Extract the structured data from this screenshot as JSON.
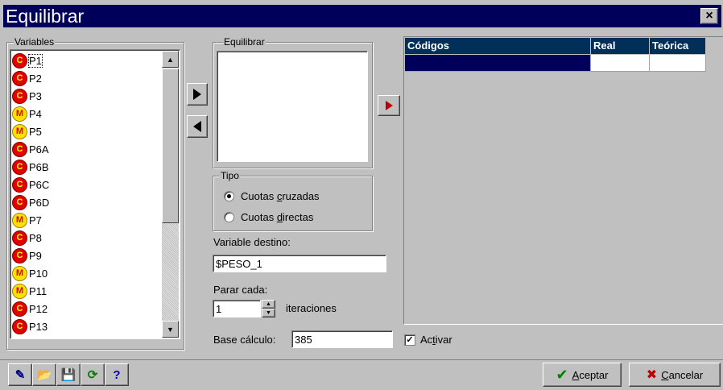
{
  "window": {
    "title": "Equilibrar",
    "close_label": "×"
  },
  "variables": {
    "label": "Variables",
    "items": [
      {
        "name": "P1",
        "type": "C",
        "selected": true
      },
      {
        "name": "P2",
        "type": "C"
      },
      {
        "name": "P3",
        "type": "C"
      },
      {
        "name": "P4",
        "type": "M"
      },
      {
        "name": "P5",
        "type": "M"
      },
      {
        "name": "P6A",
        "type": "C"
      },
      {
        "name": "P6B",
        "type": "C"
      },
      {
        "name": "P6C",
        "type": "C"
      },
      {
        "name": "P6D",
        "type": "C"
      },
      {
        "name": "P7",
        "type": "M"
      },
      {
        "name": "P8",
        "type": "C"
      },
      {
        "name": "P9",
        "type": "C"
      },
      {
        "name": "P10",
        "type": "M"
      },
      {
        "name": "P11",
        "type": "M"
      },
      {
        "name": "P12",
        "type": "C"
      },
      {
        "name": "P13",
        "type": "C"
      }
    ]
  },
  "equilibrar": {
    "label": "Equilibrar"
  },
  "tipo": {
    "label": "Tipo",
    "options": [
      {
        "pre": "Cuotas ",
        "acc": "c",
        "post": "ruzadas",
        "checked": true
      },
      {
        "pre": "Cuotas ",
        "acc": "d",
        "post": "irectas",
        "checked": false
      }
    ]
  },
  "destino": {
    "label": "Variable destino:",
    "value": "$PESO_1"
  },
  "parar": {
    "label": "Parar cada:",
    "value": "1",
    "suffix": "iteraciones"
  },
  "base": {
    "label": "Base cálculo:",
    "value": "385"
  },
  "activar": {
    "pre": "Ac",
    "acc": "t",
    "post": "ivar",
    "checked": true,
    "mark": "✓"
  },
  "grid": {
    "columns": [
      "Códigos",
      "Real",
      "Teórica"
    ]
  },
  "buttons": {
    "aceptar": {
      "acc": "A",
      "rest": "ceptar",
      "icon": "✔"
    },
    "cancelar": {
      "acc": "C",
      "rest": "ancelar",
      "icon": "✖"
    }
  },
  "toolbar": [
    {
      "name": "wizard-icon",
      "glyph": "✎"
    },
    {
      "name": "open-folder-icon",
      "glyph": "📂"
    },
    {
      "name": "save-icon",
      "glyph": "💾"
    },
    {
      "name": "refresh-icon",
      "glyph": "⟳"
    },
    {
      "name": "help-icon",
      "glyph": "?"
    }
  ],
  "colors": {
    "titlebar": "#00005a",
    "grid_header": "#00305a",
    "accent_red": "#c00000"
  }
}
